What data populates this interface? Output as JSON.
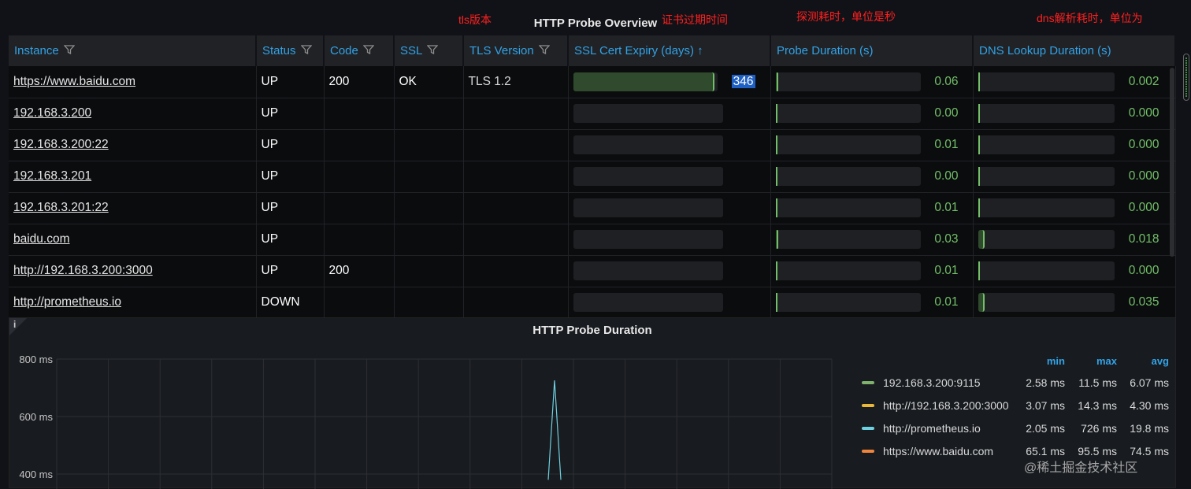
{
  "annotations": {
    "tls": "tls版本",
    "expiry": "证书过期时间",
    "probe": "探测耗时，单位是秒",
    "dns": "dns解析耗时，单位为"
  },
  "overview": {
    "title": "HTTP Probe Overview",
    "columns": [
      "Instance",
      "Status",
      "Code",
      "SSL",
      "TLS Version",
      "SSL Cert Expiry (days) ↑",
      "Probe Duration (s)",
      "DNS Lookup Duration (s)"
    ],
    "rows": [
      {
        "instance": "https://www.baidu.com",
        "status": "UP",
        "code": "200",
        "ssl": "OK",
        "tls": "TLS 1.2",
        "expiry": "346",
        "expiry_frac": 0.98,
        "probe": "0.06",
        "dns": "0.002"
      },
      {
        "instance": "192.168.3.200",
        "status": "UP",
        "code": "",
        "ssl": "",
        "tls": "",
        "expiry": "",
        "expiry_frac": 0,
        "probe": "0.00",
        "dns": "0.000"
      },
      {
        "instance": "192.168.3.200:22",
        "status": "UP",
        "code": "",
        "ssl": "",
        "tls": "",
        "expiry": "",
        "expiry_frac": 0,
        "probe": "0.01",
        "dns": "0.000"
      },
      {
        "instance": "192.168.3.201",
        "status": "UP",
        "code": "",
        "ssl": "",
        "tls": "",
        "expiry": "",
        "expiry_frac": 0,
        "probe": "0.00",
        "dns": "0.000"
      },
      {
        "instance": "192.168.3.201:22",
        "status": "UP",
        "code": "",
        "ssl": "",
        "tls": "",
        "expiry": "",
        "expiry_frac": 0,
        "probe": "0.01",
        "dns": "0.000"
      },
      {
        "instance": "baidu.com",
        "status": "UP",
        "code": "",
        "ssl": "",
        "tls": "",
        "expiry": "",
        "expiry_frac": 0,
        "probe": "0.03",
        "dns": "0.018"
      },
      {
        "instance": "http://192.168.3.200:3000",
        "status": "UP",
        "code": "200",
        "ssl": "",
        "tls": "",
        "expiry": "",
        "expiry_frac": 0,
        "probe": "0.01",
        "dns": "0.000"
      },
      {
        "instance": "http://prometheus.io",
        "status": "DOWN",
        "code": "",
        "ssl": "",
        "tls": "",
        "expiry": "",
        "expiry_frac": 0,
        "probe": "0.01",
        "dns": "0.035"
      }
    ]
  },
  "duration_panel": {
    "title": "HTTP Probe Duration",
    "info_icon": "i",
    "legend_headers": [
      "min",
      "max",
      "avg"
    ],
    "legend": [
      {
        "name": "192.168.3.200:9115",
        "color": "#7eb26d",
        "min": "2.58 ms",
        "max": "11.5 ms",
        "avg": "6.07 ms"
      },
      {
        "name": "http://192.168.3.200:3000",
        "color": "#eab839",
        "min": "3.07 ms",
        "max": "14.3 ms",
        "avg": "4.30 ms"
      },
      {
        "name": "http://prometheus.io",
        "color": "#6ed0e0",
        "min": "2.05 ms",
        "max": "726 ms",
        "avg": "19.8 ms"
      },
      {
        "name": "https://www.baidu.com",
        "color": "#ef843c",
        "min": "65.1 ms",
        "max": "95.5 ms",
        "avg": "74.5 ms"
      }
    ]
  },
  "chart_data": {
    "type": "line",
    "title": "HTTP Probe Duration",
    "yticks": [
      "800 ms",
      "600 ms",
      "400 ms"
    ],
    "ylim": [
      400,
      800
    ],
    "series": [
      {
        "name": "http://prometheus.io",
        "points": [
          [
            0,
            380
          ],
          [
            0.4,
            380
          ],
          [
            0.5,
            726
          ],
          [
            0.6,
            380
          ],
          [
            1,
            380
          ]
        ]
      }
    ]
  },
  "watermark": "@稀土掘金技术社区"
}
